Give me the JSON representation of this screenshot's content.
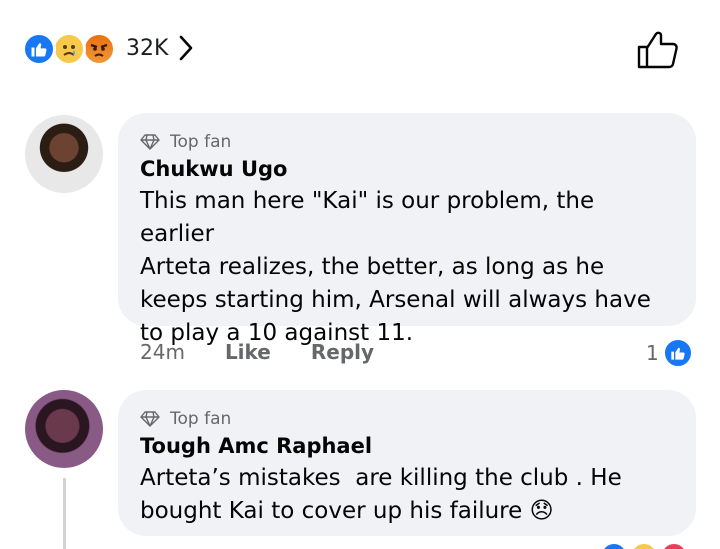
{
  "reactions": {
    "icons": [
      "like-icon",
      "sad-icon",
      "angry-icon"
    ],
    "count": "32K",
    "colors": {
      "like": "#1877f2",
      "sad": "#f7c94b",
      "angry": "#e9710f"
    }
  },
  "comments": [
    {
      "badge": "Top fan",
      "author": "Chukwu Ugo",
      "text": "This man here \"Kai\" is our problem, the earlier\nArteta realizes, the better, as long as he\nkeeps starting him, Arsenal will always have\nto play a 10 against 11.",
      "time": "24m",
      "like_label": "Like",
      "reply_label": "Reply",
      "like_count": "1"
    },
    {
      "badge": "Top fan",
      "author": "Tough Amc Raphael",
      "text": "Arteta’s mistakes  are killing the club . He\nbought Kai to cover up his failure 😞"
    }
  ]
}
